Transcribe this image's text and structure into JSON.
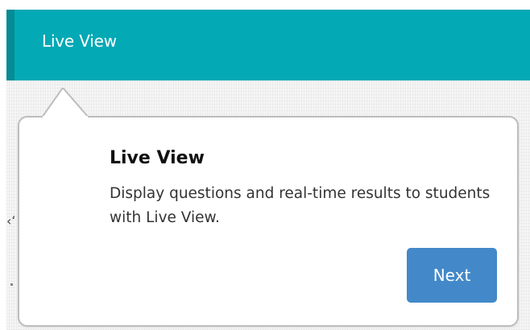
{
  "header": {
    "title": "Live View"
  },
  "background": {
    "partial_text": "‹ʻ"
  },
  "popover": {
    "title": "Live View",
    "body": "Display questions and real-time results to students with Live View.",
    "next_label": "Next"
  },
  "colors": {
    "header_bg": "#03a9b5",
    "header_edge": "#058c95",
    "button_bg": "#4389c9"
  }
}
